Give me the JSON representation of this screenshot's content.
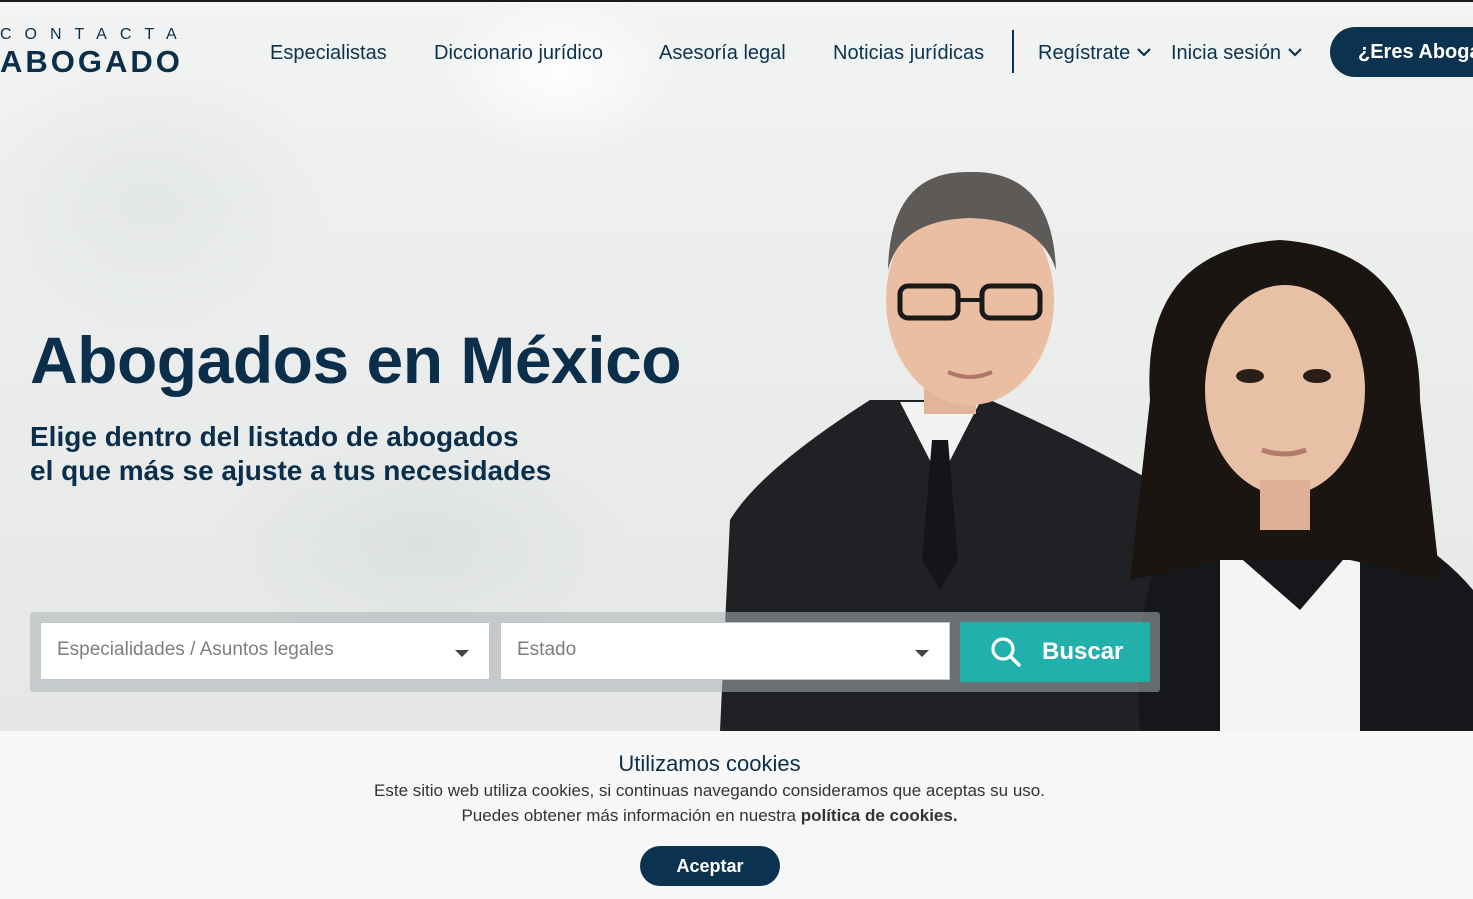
{
  "logo": {
    "top": "CONTACTA",
    "main": "ABOGADO"
  },
  "nav": {
    "items": [
      "Especialistas",
      "Diccionario jurídico",
      "Asesoría legal",
      "Noticias jurídicas"
    ],
    "register": "Regístrate",
    "login": "Inicia sesión",
    "cta": "¿Eres Abogado?"
  },
  "hero": {
    "title": "Abogados en México",
    "subtitle_line1": "Elige dentro del listado de abogados",
    "subtitle_line2": "el que más se ajuste a tus necesidades"
  },
  "search": {
    "specialty_placeholder": "Especialidades / Asuntos legales",
    "state_placeholder": "Estado",
    "button": "Buscar",
    "accent_color": "#22b0ad"
  },
  "cookies": {
    "title": "Utilizamos cookies",
    "line1": "Este sitio web utiliza cookies, si continuas navegando consideramos que aceptas su uso.",
    "line2_prefix": "Puedes obtener más información en nuestra",
    "line2_link": "política de cookies.",
    "accept": "Aceptar"
  },
  "colors": {
    "brand": "#0b3350",
    "accent": "#22b0ad"
  }
}
